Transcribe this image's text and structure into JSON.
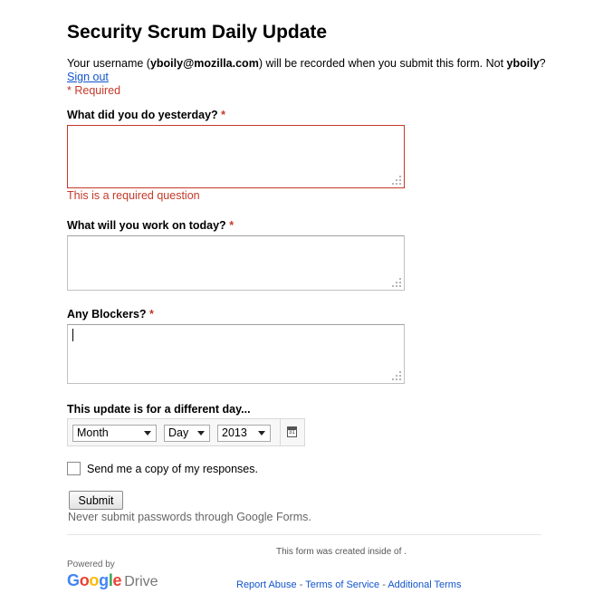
{
  "form": {
    "title": "Security Scrum Daily Update",
    "intro_prefix": "Your username (",
    "username": "yboily@mozilla.com",
    "intro_middle": ") will be recorded when you submit this form. Not ",
    "short_user": "yboily",
    "intro_suffix": "?",
    "sign_out": "Sign out",
    "required_note": "* Required",
    "questions": [
      {
        "label": "What did you do yesterday?",
        "required_mark": "*",
        "value": "",
        "error": "This is a required question"
      },
      {
        "label": "What will you work on today?",
        "required_mark": "*",
        "value": ""
      },
      {
        "label": "Any Blockers?",
        "required_mark": "*",
        "value": ""
      }
    ],
    "date_label": "This update is for a different day...",
    "date": {
      "month": "Month",
      "day": "Day",
      "year": "2013",
      "calendar_icon_text": "31"
    },
    "copy_label": "Send me a copy of my responses.",
    "copy_checked": false,
    "submit_label": "Submit",
    "password_warning": "Never submit passwords through Google Forms."
  },
  "footer": {
    "created_text": "This form was created inside of .",
    "powered_by": "Powered by",
    "logo_google": "Google",
    "logo_drive": "Drive",
    "links": [
      "Report Abuse",
      "Terms of Service",
      "Additional Terms"
    ],
    "separator": " - "
  },
  "colors": {
    "google_blue": "#4285f4",
    "google_red": "#ea4335",
    "google_yellow": "#fbbc05",
    "google_green": "#34a853",
    "error": "#c53929",
    "link": "#1155cc"
  }
}
